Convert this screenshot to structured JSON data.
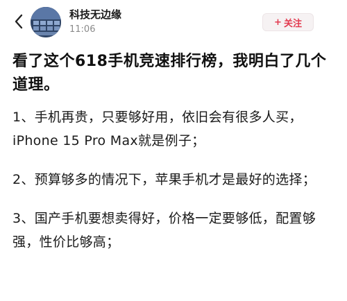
{
  "header": {
    "author_name": "科技无边缘",
    "post_time": "11:06",
    "follow_label": "关注",
    "follow_plus": "+"
  },
  "article": {
    "title": "看了这个618手机竞速排行榜，我明白了几个道理。",
    "paragraphs": [
      "1、手机再贵，只要够好用，依旧会有很多人买，iPhone 15 Pro Max就是例子；",
      "2、预算够多的情况下，苹果手机才是最好的选择；",
      "3、国产手机要想卖得好，价格一定要够低，配置够强，性价比够高；"
    ]
  },
  "icons": {
    "back": "chevron-left-icon",
    "avatar": "avatar-image"
  },
  "colors": {
    "accent": "#e23a4f",
    "follow_bg": "#f6f2f3",
    "muted_text": "#8a8a8a"
  }
}
